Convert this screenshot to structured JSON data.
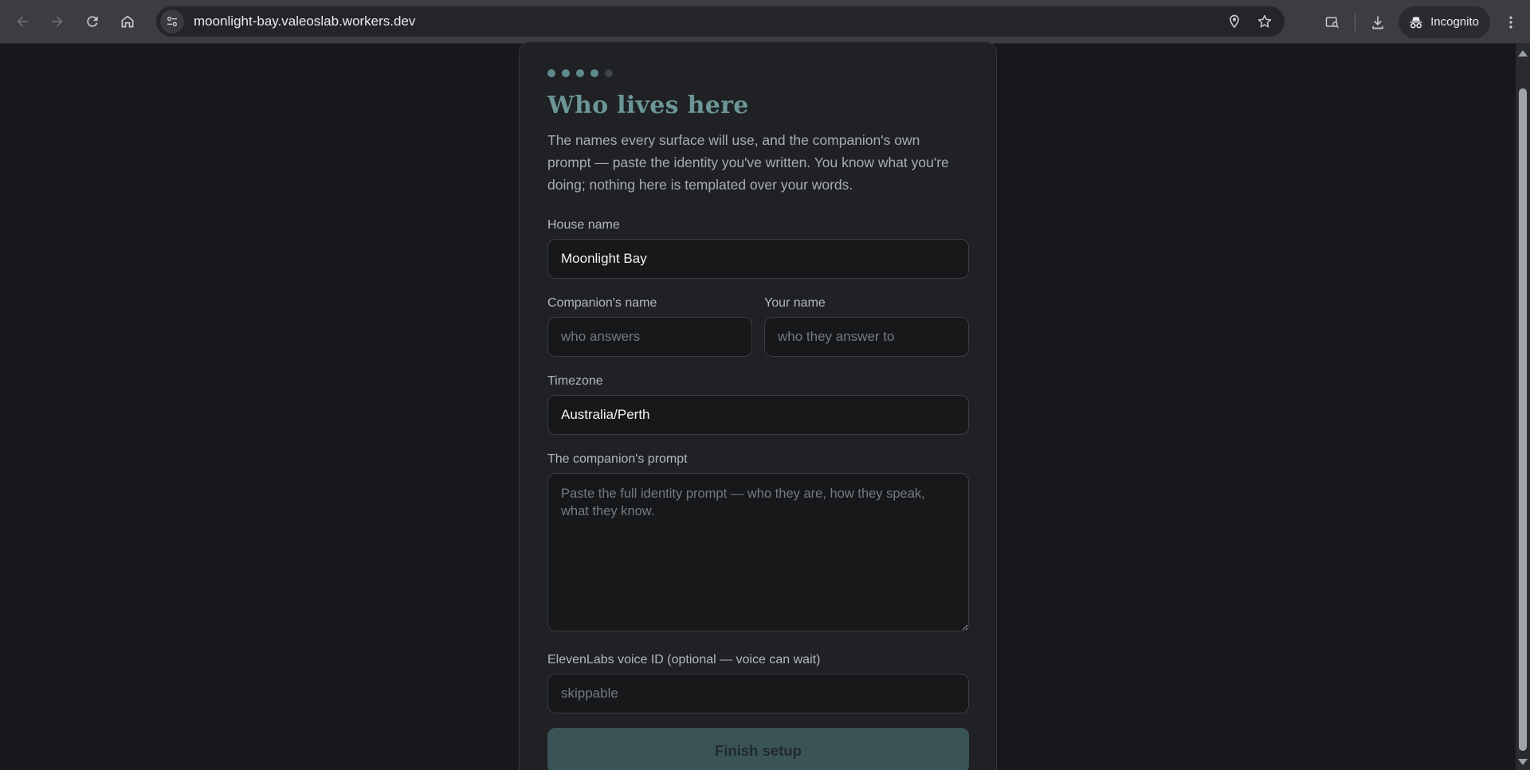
{
  "browser": {
    "url": "moonlight-bay.valeoslab.workers.dev",
    "profile_label": "Incognito"
  },
  "wizard": {
    "steps_total": 5,
    "steps_complete": 4,
    "title": "Who lives here",
    "description": "The names every surface will use, and the companion's own prompt — paste the identity you've written. You know what you're doing; nothing here is templated over your words.",
    "house_name": {
      "label": "House name",
      "value": "Moonlight Bay"
    },
    "companion_name": {
      "label": "Companion's name",
      "placeholder": "who answers"
    },
    "your_name": {
      "label": "Your name",
      "placeholder": "who they answer to"
    },
    "timezone": {
      "label": "Timezone",
      "value": "Australia/Perth"
    },
    "prompt": {
      "label": "The companion's prompt",
      "placeholder": "Paste the full identity prompt — who they are, how they speak, what they know."
    },
    "voice_id": {
      "label": "ElevenLabs voice ID (optional — voice can wait)",
      "placeholder": "skippable"
    },
    "finish_label": "Finish setup"
  },
  "colors": {
    "accent": "#6b9596",
    "button_bg": "#3a5357",
    "page_bg": "#16181b",
    "card_bg": "#1f2124"
  }
}
